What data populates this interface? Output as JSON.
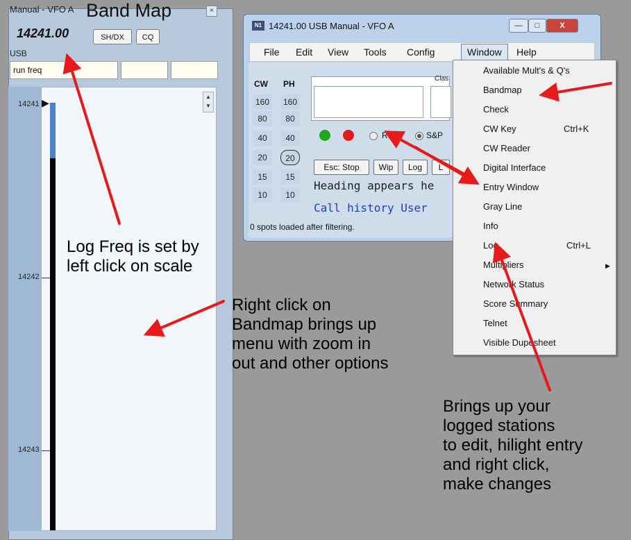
{
  "bandmap": {
    "title_small": "Manual - VFO A",
    "title_big": "Band Map",
    "close_glyph": "×",
    "freq": "14241.00",
    "btn_shdx": "SH/DX",
    "btn_cq": "CQ",
    "mode": "USB",
    "run_field": "run freq",
    "scale": {
      "ticks": [
        "14241",
        "14242",
        "14243"
      ],
      "scroll_up": "▲",
      "scroll_down": "▼",
      "marker_glyph": "▶"
    }
  },
  "main_window": {
    "logo": "N1",
    "title": "14241.00 USB Manual - VFO A",
    "min_glyph": "—",
    "max_glyph": "□",
    "close_glyph": "X",
    "menu": [
      "File",
      "Edit",
      "View",
      "Tools",
      "Config",
      "Window",
      "Help"
    ],
    "bands": {
      "cw_header": "CW",
      "ph_header": "PH",
      "cw": [
        "160",
        "80",
        "40",
        "20",
        "15",
        "10"
      ],
      "ph": [
        "160",
        "80",
        "40",
        "20",
        "15",
        "10"
      ]
    },
    "class_label": "Clas",
    "radio_run": "Run",
    "radio_sp": "S&P",
    "buttons": [
      "Esc: Stop",
      "Wip",
      "Log",
      "L"
    ],
    "heading_text": "Heading appears he",
    "callhist_text": "Call history User",
    "status": "0 spots loaded after filtering."
  },
  "window_menu": {
    "items": [
      {
        "label": "Available Mult's & Q's",
        "shortcut": ""
      },
      {
        "label": "Bandmap",
        "shortcut": ""
      },
      {
        "label": "Check",
        "shortcut": ""
      },
      {
        "label": "CW Key",
        "shortcut": "Ctrl+K"
      },
      {
        "label": "CW Reader",
        "shortcut": ""
      },
      {
        "label": "Digital Interface",
        "shortcut": ""
      },
      {
        "label": "Entry Window",
        "shortcut": ""
      },
      {
        "label": "Gray Line",
        "shortcut": ""
      },
      {
        "label": "Info",
        "shortcut": ""
      },
      {
        "label": "Log",
        "shortcut": "Ctrl+L"
      },
      {
        "label": "Multipliers",
        "shortcut": ""
      },
      {
        "label": "Network Status",
        "shortcut": ""
      },
      {
        "label": "Score Summary",
        "shortcut": ""
      },
      {
        "label": "Telnet",
        "shortcut": ""
      },
      {
        "label": "Visible Dupesheet",
        "shortcut": ""
      }
    ],
    "submenu_arrow": "▶"
  },
  "annotations": {
    "log_freq": [
      "Log Freq is set by",
      "left click on scale"
    ],
    "right_click": [
      "Right click on",
      "Bandmap brings up",
      "menu with zoom in",
      "out and other options"
    ],
    "brings_up": [
      "Brings up your",
      "logged stations",
      "to edit, hilight entry",
      "and right click,",
      "make changes"
    ]
  },
  "colors": {
    "arrow": "#e8191a",
    "green_dot": "#1fa51f",
    "red_dot": "#e01b1b"
  }
}
